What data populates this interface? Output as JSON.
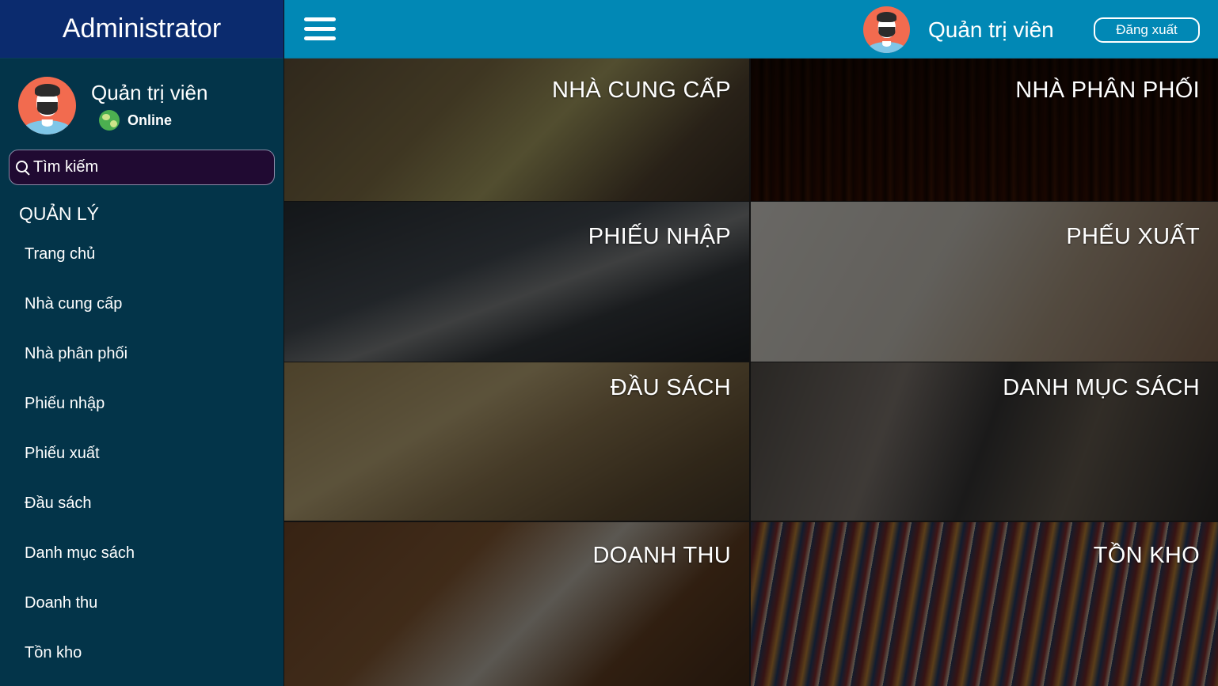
{
  "sidebar": {
    "brand": "Administrator",
    "user": {
      "name": "Quản trị viên",
      "status": "Online"
    },
    "search": {
      "placeholder": "Tìm kiếm"
    },
    "section_title": "QUẢN LÝ",
    "menu": [
      {
        "label": "Trang chủ"
      },
      {
        "label": "Nhà cung cấp"
      },
      {
        "label": "Nhà phân phối"
      },
      {
        "label": "Phiếu nhập"
      },
      {
        "label": "Phiếu xuất"
      },
      {
        "label": "Đầu sách"
      },
      {
        "label": "Danh mục sách"
      },
      {
        "label": "Doanh thu"
      },
      {
        "label": "Tồn kho"
      }
    ]
  },
  "header": {
    "user_name": "Quản trị viên",
    "logout_label": "Đăng xuất"
  },
  "tiles": [
    {
      "label": "NHÀ CUNG CẤP"
    },
    {
      "label": "NHÀ PHÂN PHỐI"
    },
    {
      "label": "PHIẾU NHẬP"
    },
    {
      "label": "PHẾU XUẤT"
    },
    {
      "label": "ĐẦU SÁCH"
    },
    {
      "label": "DANH MỤC SÁCH"
    },
    {
      "label": "DOANH THU"
    },
    {
      "label": "TỒN KHO"
    }
  ],
  "icons": {
    "menu": "hamburger-menu-icon",
    "search": "search-icon",
    "status": "globe-icon",
    "avatar": "user-avatar-icon"
  },
  "colors": {
    "sidebar_bg": "#033449",
    "brand_bg": "#0b2b6e",
    "topbar_bg": "#0188b5",
    "avatar_bg": "#f26b4f",
    "search_bg": "#200a32"
  }
}
